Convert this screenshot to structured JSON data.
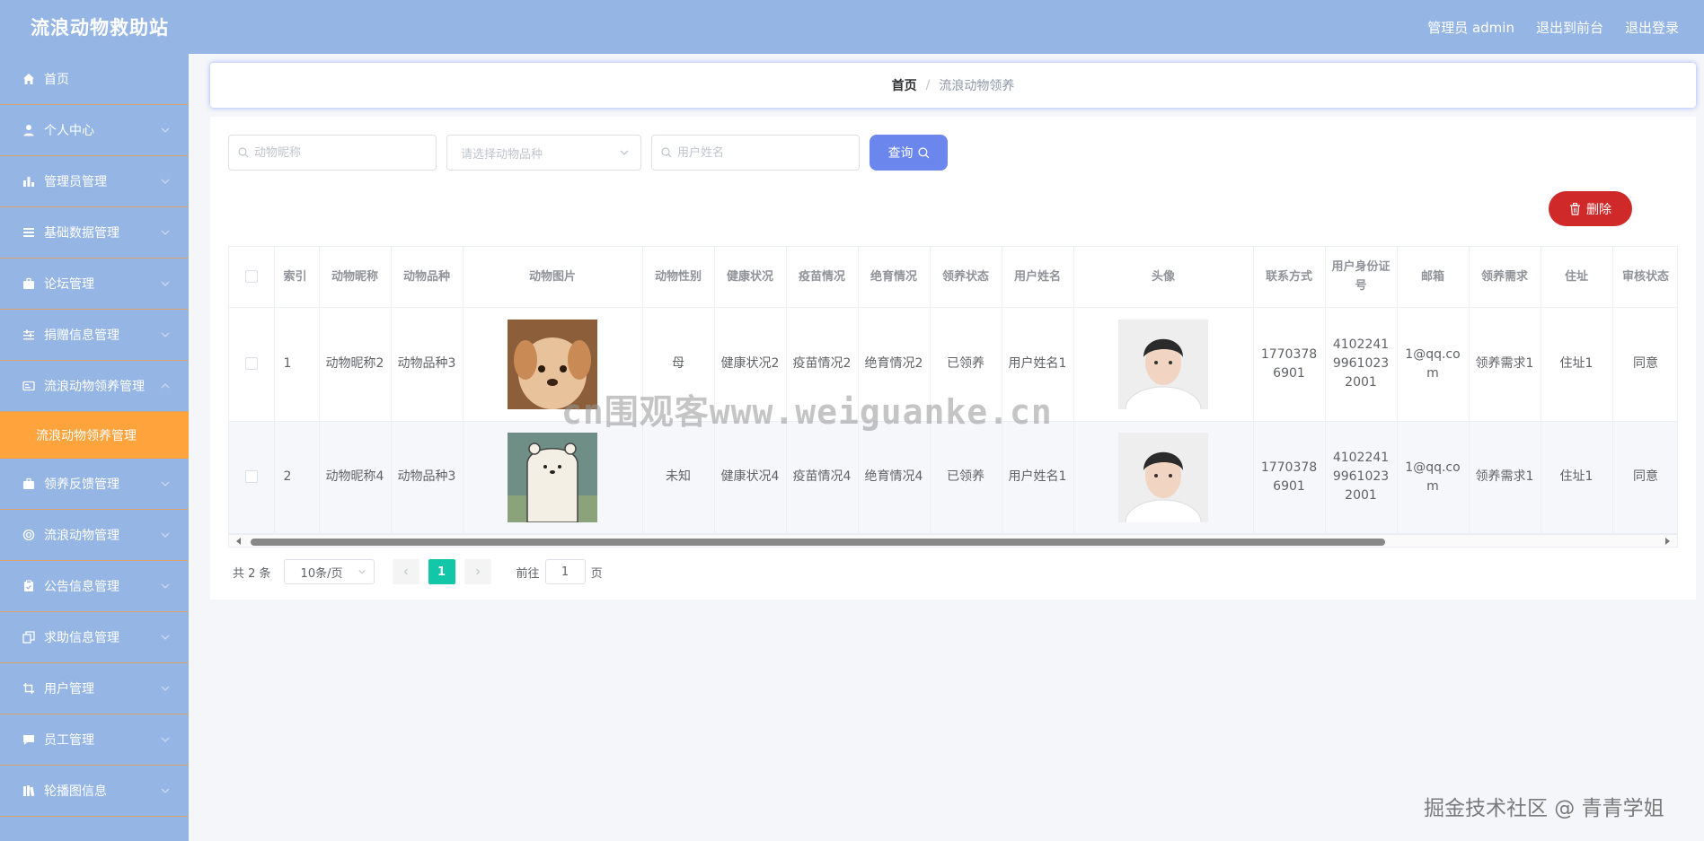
{
  "header": {
    "brand": "流浪动物救助站",
    "admin": "管理员 admin",
    "to_front": "退出到前台",
    "logout": "退出登录"
  },
  "sidebar": {
    "items": [
      {
        "label": "首页",
        "icon": "home-icon"
      },
      {
        "label": "个人中心",
        "icon": "user-icon"
      },
      {
        "label": "管理员管理",
        "icon": "bar-chart-icon"
      },
      {
        "label": "基础数据管理",
        "icon": "list-icon"
      },
      {
        "label": "论坛管理",
        "icon": "briefcase-icon"
      },
      {
        "label": "捐赠信息管理",
        "icon": "sliders-icon"
      },
      {
        "label": "流浪动物领养管理",
        "icon": "card-icon"
      }
    ],
    "active_sub": "流浪动物领养管理",
    "items_after": [
      {
        "label": "领养反馈管理",
        "icon": "briefcase-icon"
      },
      {
        "label": "流浪动物管理",
        "icon": "target-icon"
      },
      {
        "label": "公告信息管理",
        "icon": "clipboard-icon"
      },
      {
        "label": "求助信息管理",
        "icon": "copy-icon"
      },
      {
        "label": "用户管理",
        "icon": "crop-icon"
      },
      {
        "label": "员工管理",
        "icon": "message-icon"
      },
      {
        "label": "轮播图信息",
        "icon": "books-icon"
      }
    ]
  },
  "breadcrumb": {
    "home": "首页",
    "separator": "/",
    "current": "流浪动物领养"
  },
  "search": {
    "name_placeholder": "动物昵称",
    "breed_placeholder": "请选择动物品种",
    "user_placeholder": "用户姓名",
    "query_label": "查询"
  },
  "delete_label": "删除",
  "table": {
    "columns": [
      "索引",
      "动物昵称",
      "动物品种",
      "动物图片",
      "动物性别",
      "健康状况",
      "疫苗情况",
      "绝育情况",
      "领养状态",
      "用户姓名",
      "头像",
      "联系方式",
      "用户身份证号",
      "邮箱",
      "领养需求",
      "住址",
      "审核状态"
    ],
    "rows": [
      {
        "index": "1",
        "nickname": "动物昵称2",
        "breed": "动物品种3",
        "image": "puppy-photo",
        "gender": "母",
        "health": "健康状况2",
        "vaccine": "疫苗情况2",
        "sterilization": "绝育情况2",
        "status": "已领养",
        "username": "用户姓名1",
        "avatar": "user-avatar-photo",
        "phone": "17703786901",
        "id_number": "410224199610232001",
        "email": "1@qq.com",
        "demand": "领养需求1",
        "address": "住址1",
        "review": "同意"
      },
      {
        "index": "2",
        "nickname": "动物昵称4",
        "breed": "动物品种3",
        "image": "polar-bear-cartoon",
        "gender": "未知",
        "health": "健康状况4",
        "vaccine": "疫苗情况4",
        "sterilization": "绝育情况4",
        "status": "已领养",
        "username": "用户姓名1",
        "avatar": "user-avatar-photo",
        "phone": "17703786901",
        "id_number": "410224199610232001",
        "email": "1@qq.com",
        "demand": "领养需求1",
        "address": "住址1",
        "review": "同意"
      }
    ]
  },
  "pagination": {
    "total": "共 2 条",
    "page_size": "10条/页",
    "current_page": "1",
    "goto_label": "前往",
    "goto_value": "1",
    "page_suffix": "页"
  },
  "watermark": "cn围观客www.weiguanke.cn",
  "credit": "掘金技术社区 @ 青青学姐",
  "colors": {
    "header_bg": "#95b6e4",
    "active_menu": "#ffa33c",
    "query_btn": "#6b86ed",
    "delete_btn": "#d02929",
    "page_active": "#12c6a8"
  }
}
